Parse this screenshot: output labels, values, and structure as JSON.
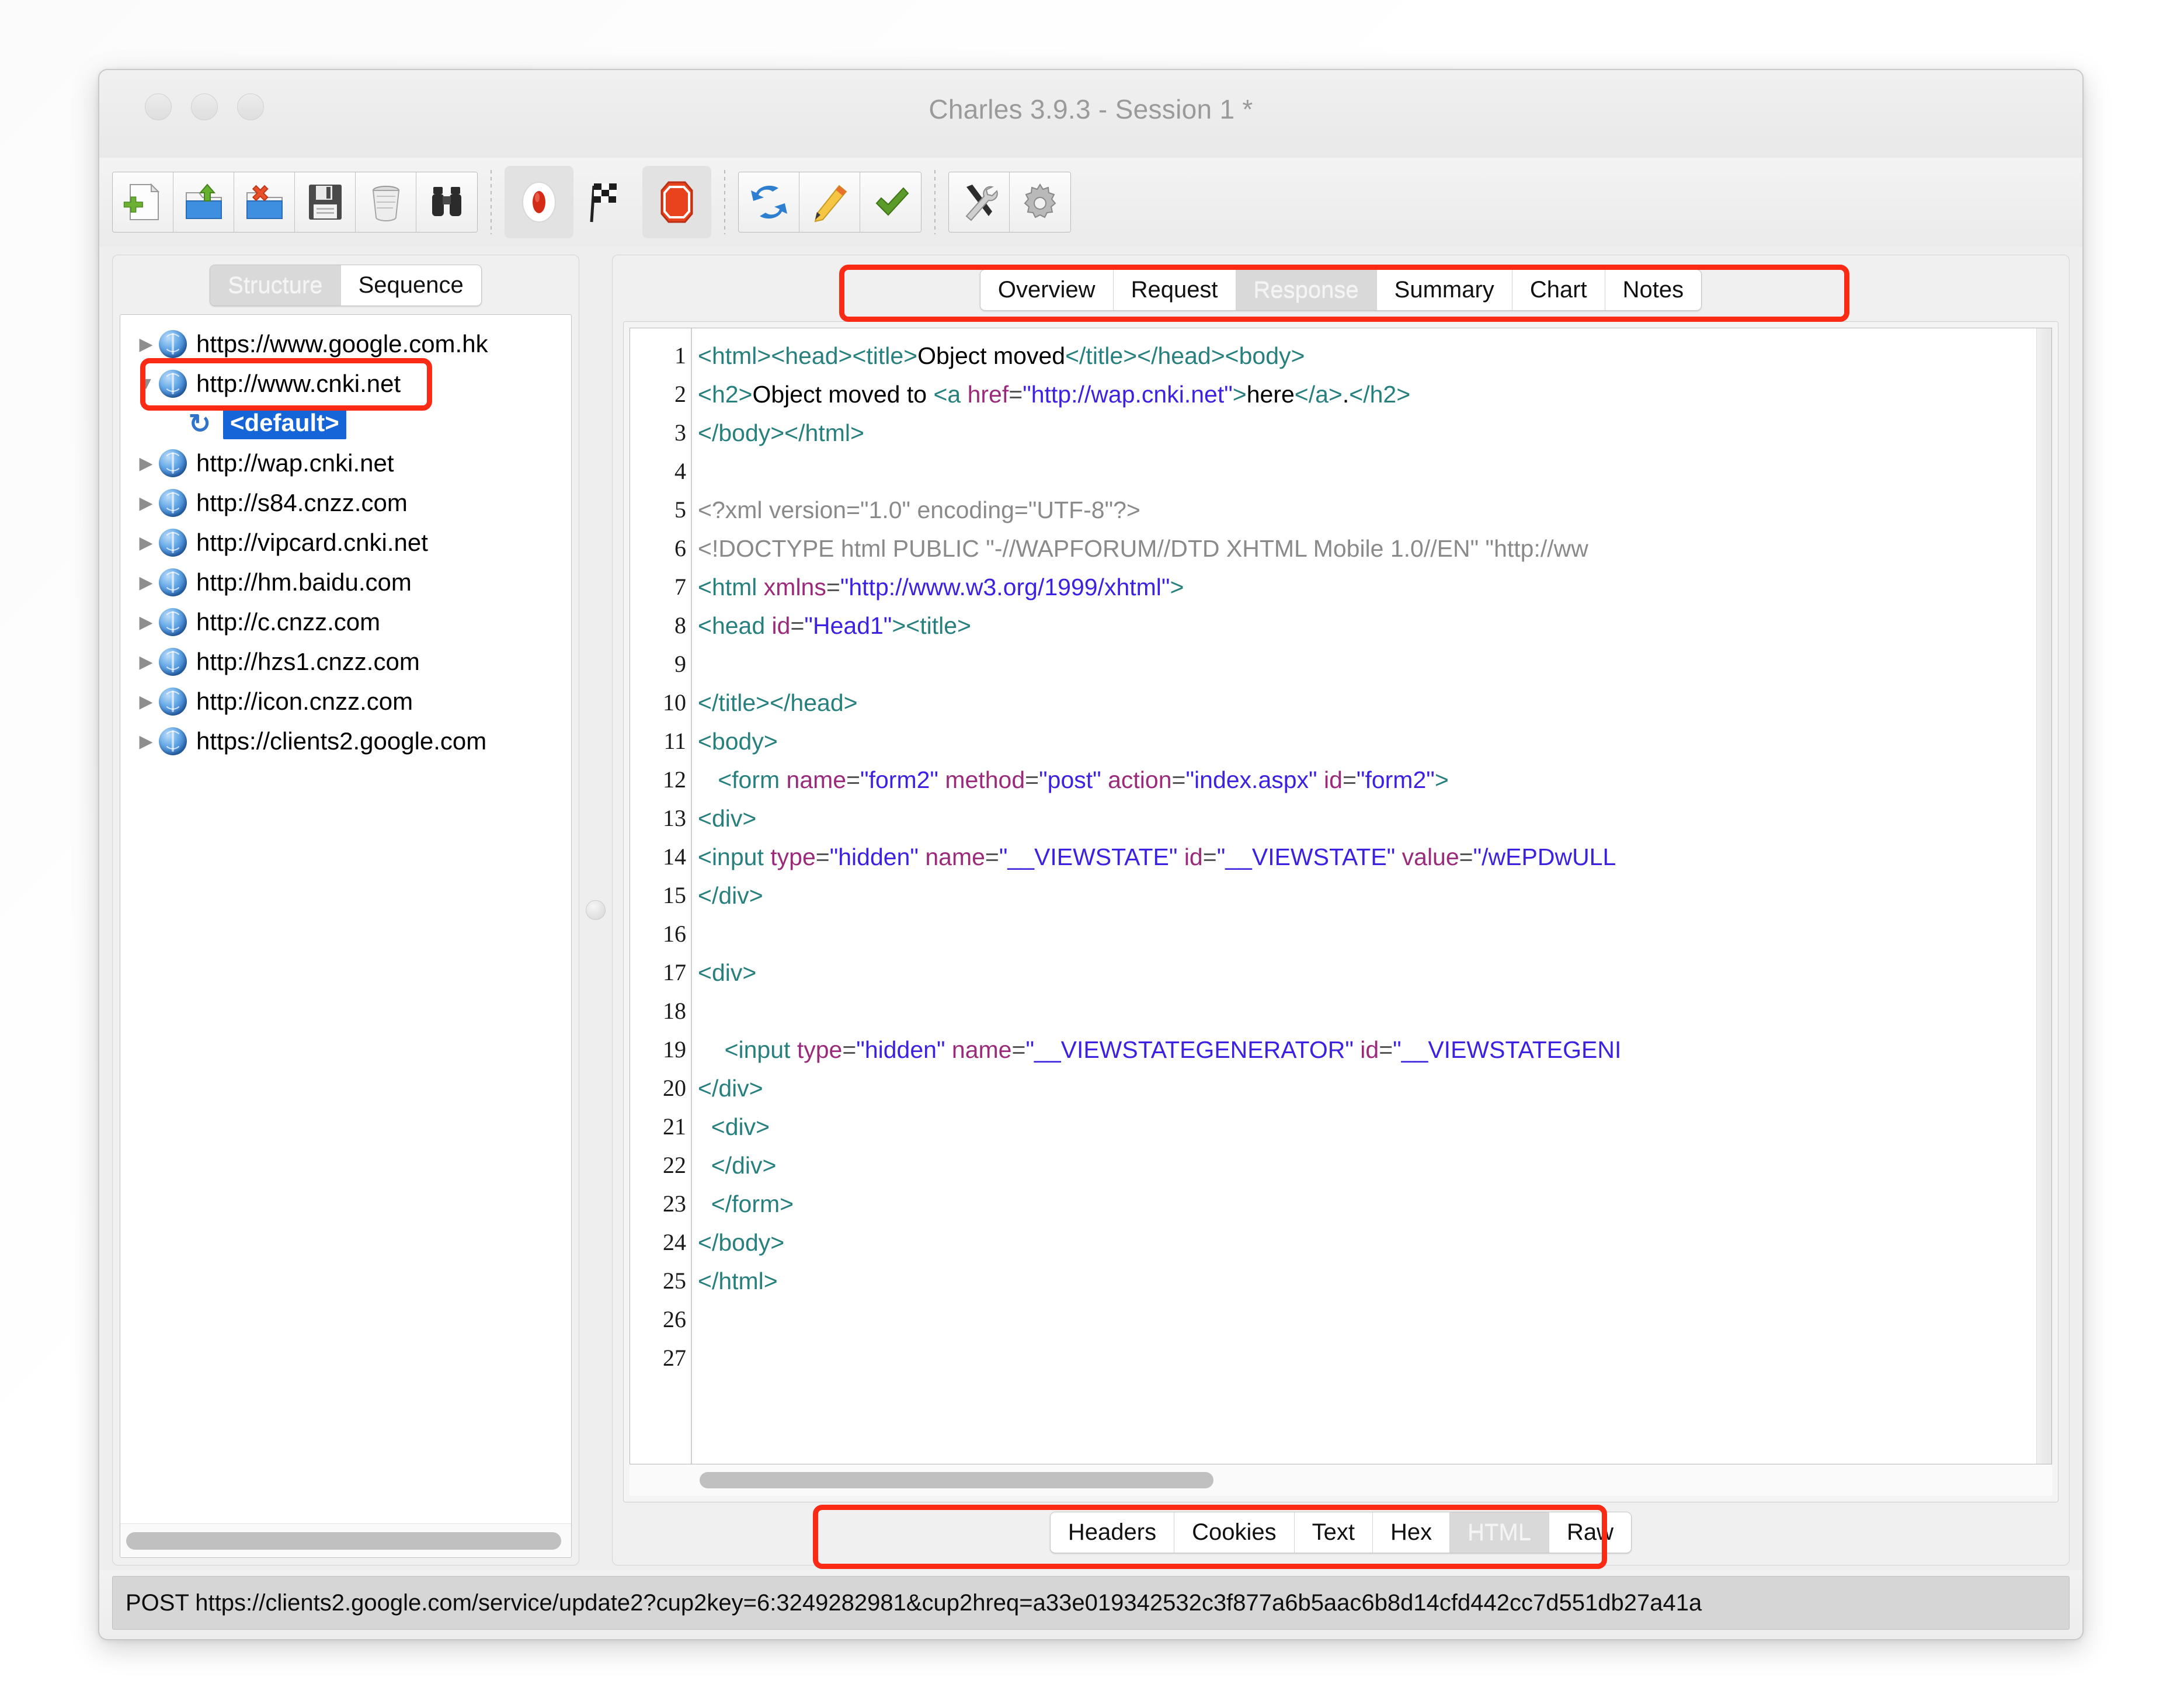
{
  "window": {
    "title": "Charles 3.9.3 - Session 1 *",
    "traffic_lights": [
      "close-button",
      "minimize-button",
      "zoom-button"
    ]
  },
  "toolbar": {
    "groups": [
      {
        "name": "file-group",
        "buttons": [
          {
            "name": "new-session-button",
            "icon": "new-document-icon"
          },
          {
            "name": "open-session-button",
            "icon": "open-folder-icon"
          },
          {
            "name": "close-session-button",
            "icon": "close-folder-icon"
          },
          {
            "name": "save-session-button",
            "icon": "floppy-disk-icon"
          },
          {
            "name": "clear-session-button",
            "icon": "trash-can-icon"
          },
          {
            "name": "find-button",
            "icon": "binoculars-icon"
          }
        ]
      },
      {
        "name": "record-group",
        "buttons": [
          {
            "name": "record-button",
            "icon": "record-circle-icon",
            "state": "pressed"
          },
          {
            "name": "start-stop-throttling-button",
            "icon": "checkered-flag-icon",
            "state": "normal"
          },
          {
            "name": "stop-button",
            "icon": "stop-octagon-icon",
            "state": "pressed"
          }
        ]
      },
      {
        "name": "tools-group",
        "buttons": [
          {
            "name": "repeat-button",
            "icon": "refresh-arrows-icon"
          },
          {
            "name": "compose-button",
            "icon": "pencil-icon"
          },
          {
            "name": "validate-button",
            "icon": "green-check-icon"
          }
        ]
      },
      {
        "name": "settings-group",
        "buttons": [
          {
            "name": "tools-button",
            "icon": "screwdriver-wrench-icon"
          },
          {
            "name": "settings-button",
            "icon": "gear-icon"
          }
        ]
      }
    ]
  },
  "sidebar": {
    "view_tabs": [
      {
        "label": "Structure",
        "selected": true
      },
      {
        "label": "Sequence",
        "selected": false
      }
    ],
    "tree": [
      {
        "label": "https://www.google.com.hk",
        "expanded": false,
        "indent": 0,
        "icon": "globe-icon",
        "highlighted": false
      },
      {
        "label": "http://www.cnki.net",
        "expanded": true,
        "indent": 0,
        "icon": "globe-icon",
        "highlighted": true
      },
      {
        "label": "<default>",
        "expanded": null,
        "indent": 1,
        "icon": "refresh-icon",
        "selected": true
      },
      {
        "label": "http://wap.cnki.net",
        "expanded": false,
        "indent": 0,
        "icon": "globe-icon",
        "highlighted": false
      },
      {
        "label": "http://s84.cnzz.com",
        "expanded": false,
        "indent": 0,
        "icon": "globe-icon",
        "highlighted": false
      },
      {
        "label": "http://vipcard.cnki.net",
        "expanded": false,
        "indent": 0,
        "icon": "globe-icon",
        "highlighted": false
      },
      {
        "label": "http://hm.baidu.com",
        "expanded": false,
        "indent": 0,
        "icon": "globe-icon",
        "highlighted": false
      },
      {
        "label": "http://c.cnzz.com",
        "expanded": false,
        "indent": 0,
        "icon": "globe-icon",
        "highlighted": false
      },
      {
        "label": "http://hzs1.cnzz.com",
        "expanded": false,
        "indent": 0,
        "icon": "globe-icon",
        "highlighted": false
      },
      {
        "label": "http://icon.cnzz.com",
        "expanded": false,
        "indent": 0,
        "icon": "globe-icon",
        "highlighted": false
      },
      {
        "label": "https://clients2.google.com",
        "expanded": false,
        "indent": 0,
        "icon": "globe-icon",
        "highlighted": false
      }
    ]
  },
  "main": {
    "top_tabs": [
      {
        "label": "Overview",
        "selected": false
      },
      {
        "label": "Request",
        "selected": false
      },
      {
        "label": "Response",
        "selected": true
      },
      {
        "label": "Summary",
        "selected": false
      },
      {
        "label": "Chart",
        "selected": false
      },
      {
        "label": "Notes",
        "selected": false
      }
    ],
    "bottom_tabs": [
      {
        "label": "Headers",
        "selected": false
      },
      {
        "label": "Cookies",
        "selected": false
      },
      {
        "label": "Text",
        "selected": false
      },
      {
        "label": "Hex",
        "selected": false
      },
      {
        "label": "HTML",
        "selected": true
      },
      {
        "label": "Raw",
        "selected": false
      }
    ],
    "code": {
      "line_numbers": [
        1,
        2,
        3,
        4,
        5,
        6,
        7,
        8,
        9,
        10,
        11,
        12,
        13,
        14,
        15,
        16,
        17,
        18,
        19,
        20,
        21,
        22,
        23,
        24,
        25,
        26,
        27
      ],
      "lines": [
        "<html><head><title>Object moved</title></head><body>",
        "<h2>Object moved to <a href=\"http://wap.cnki.net\">here</a>.</h2>",
        "</body></html>",
        "",
        "<?xml version=\"1.0\" encoding=\"UTF-8\"?>",
        "<!DOCTYPE html PUBLIC \"-//WAPFORUM//DTD XHTML Mobile 1.0//EN\" \"http://ww",
        "<html xmlns=\"http://www.w3.org/1999/xhtml\">",
        "<head id=\"Head1\"><title>",
        "",
        "</title></head>",
        "<body>",
        "   <form name=\"form2\" method=\"post\" action=\"index.aspx\" id=\"form2\">",
        "<div>",
        "<input type=\"hidden\" name=\"__VIEWSTATE\" id=\"__VIEWSTATE\" value=\"/wEPDwULL",
        "</div>",
        "",
        "<div>",
        "",
        "    <input type=\"hidden\" name=\"__VIEWSTATEGENERATOR\" id=\"__VIEWSTATEGENI",
        "</div>",
        "  <div>",
        "  </div>",
        "  </form>",
        "</body>",
        "</html>",
        "",
        ""
      ]
    }
  },
  "statusbar": {
    "text": "POST https://clients2.google.com/service/update2?cup2key=6:3249282981&cup2hreq=a33e019342532c3f877a6b5aac6b8d14cfd442cc7d551db27a41a"
  },
  "annotations": {
    "highlight_color": "#fb2a14",
    "boxes": [
      "sidebar-cnki-row",
      "top-tab-bar",
      "bottom-tab-bar"
    ]
  },
  "colors": {
    "selection_blue": "#1565d8",
    "tag": "#27807d",
    "attribute": "#9b2b7a",
    "value": "#3b22e0",
    "comment": "#8a8a8a"
  }
}
